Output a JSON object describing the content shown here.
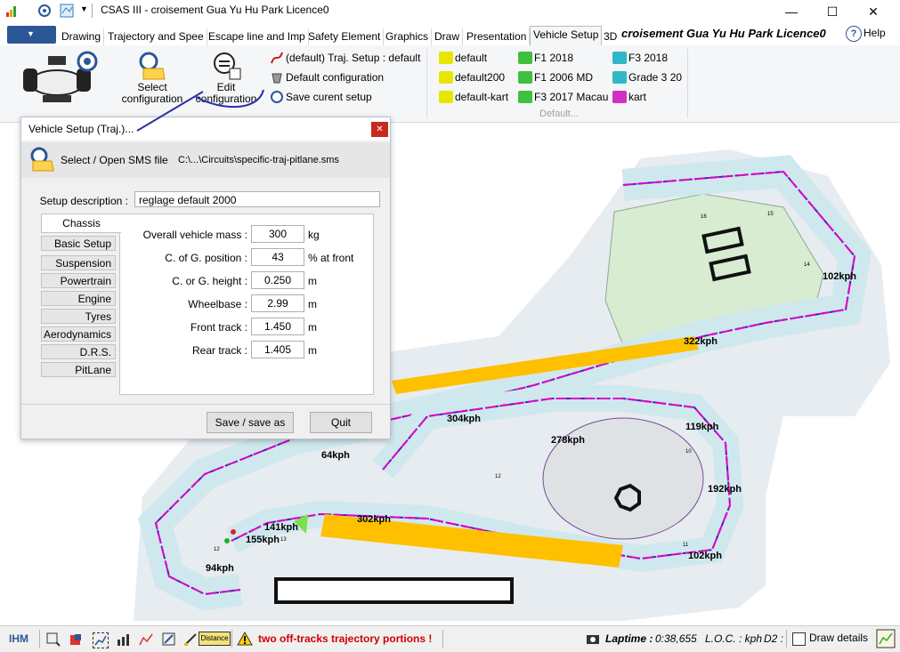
{
  "window": {
    "title": "CSAS III - croisement Gua Yu Hu Park Licence0",
    "minimize_glyph": "—",
    "maximize_glyph": "☐",
    "close_glyph": "✕"
  },
  "ribbon_tabs": [
    "Drawing",
    "Trajectory and Spee",
    "Escape line and Imp",
    "Safety Element",
    "Graphics",
    "Draw",
    "Presentation",
    "Vehicle Setup",
    "3D"
  ],
  "ribbon_banner": "croisement Gua Yu Hu Park Licence0",
  "help_label": "Help",
  "ribbon": {
    "select_config": "Select\nconfiguration",
    "edit_config": "Edit\nconfiguration",
    "traj_setup": "(default) Traj. Setup : default",
    "default_config": "Default configuration",
    "save_setup": "Save curent setup",
    "presets_col1": [
      "default",
      "default200",
      "default-kart"
    ],
    "presets_col2": [
      "F1 2018",
      "F1 2006 MD",
      "F3 2017 Macau"
    ],
    "presets_col3": [
      "F3 2018",
      "Grade 3 20",
      "kart"
    ],
    "group_default": "Default..."
  },
  "dialog": {
    "title": "Vehicle Setup (Traj.)...",
    "close_glyph": "✕",
    "open_label": "Select / Open SMS file",
    "file_path": "C:\\...\\Circuits\\specific-traj-pitlane.sms",
    "desc_label": "Setup description :",
    "desc_value": "reglage default 2000",
    "active_tab": "Chassis",
    "side_tabs": [
      "Basic Setup",
      "Suspension",
      "Powertrain",
      "Engine",
      "Tyres",
      "Aerodynamics",
      "D.R.S.",
      "PitLane"
    ],
    "fields": [
      {
        "label": "Overall vehicle mass :",
        "value": "300",
        "unit": "kg"
      },
      {
        "label": "C. of G. position :",
        "value": "43",
        "unit": "% at front"
      },
      {
        "label": "C. or G. height :",
        "value": "0.250",
        "unit": "m"
      },
      {
        "label": "Wheelbase :",
        "value": "2.99",
        "unit": "m"
      },
      {
        "label": "Front track :",
        "value": "1.450",
        "unit": "m"
      },
      {
        "label": "Rear track :",
        "value": "1.405",
        "unit": "m"
      }
    ],
    "save_button": "Save / save as",
    "quit_button": "Quit"
  },
  "map": {
    "speed_labels": [
      "102kph",
      "322kph",
      "304kph",
      "278kph",
      "119kph",
      "64kph",
      "192kph",
      "302kph",
      "141kph",
      "155kph",
      "94kph",
      "102kph"
    ],
    "turn_numbers": [
      "15",
      "16",
      "14",
      "12",
      "11",
      "13",
      "10",
      "12"
    ]
  },
  "status": {
    "mode": "IHM",
    "distance_label": "Distance",
    "warning": "two off-tracks trajectory portions !",
    "laptime_label": "Laptime :",
    "laptime_value": "0:38,655",
    "loc": "L.O.C. : kph",
    "d2": "D2 :",
    "draw_details": "Draw details"
  },
  "colors": {
    "accent_blue": "#2b5797",
    "track_fill": "#cfe8ee",
    "track_border": "#2b2fa8",
    "traj_line": "#e000c8",
    "straight_fill": "#ffc000",
    "warning_text": "#d00000",
    "grass": "#d7ecd0"
  }
}
